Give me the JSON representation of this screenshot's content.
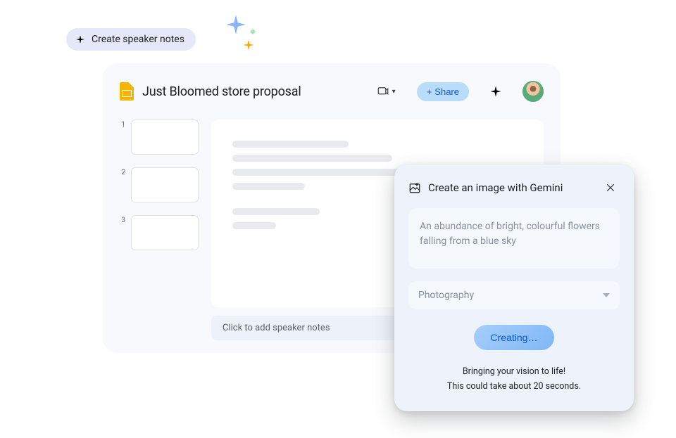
{
  "chip": {
    "label": "Create speaker notes"
  },
  "header": {
    "title": "Just Bloomed store proposal",
    "share_label": "Share"
  },
  "thumbnails": [
    {
      "index": "1"
    },
    {
      "index": "2"
    },
    {
      "index": "3"
    }
  ],
  "speaker_notes_placeholder": "Click to add speaker notes",
  "gemini_panel": {
    "title": "Create an image with Gemini",
    "prompt_placeholder": "An abundance of bright, colourful flowers falling from a blue sky",
    "style_label": "Photography",
    "button_label": "Creating…",
    "status_line_1": "Bringing your vision to life!",
    "status_line_2": "This could take about 20 seconds."
  }
}
